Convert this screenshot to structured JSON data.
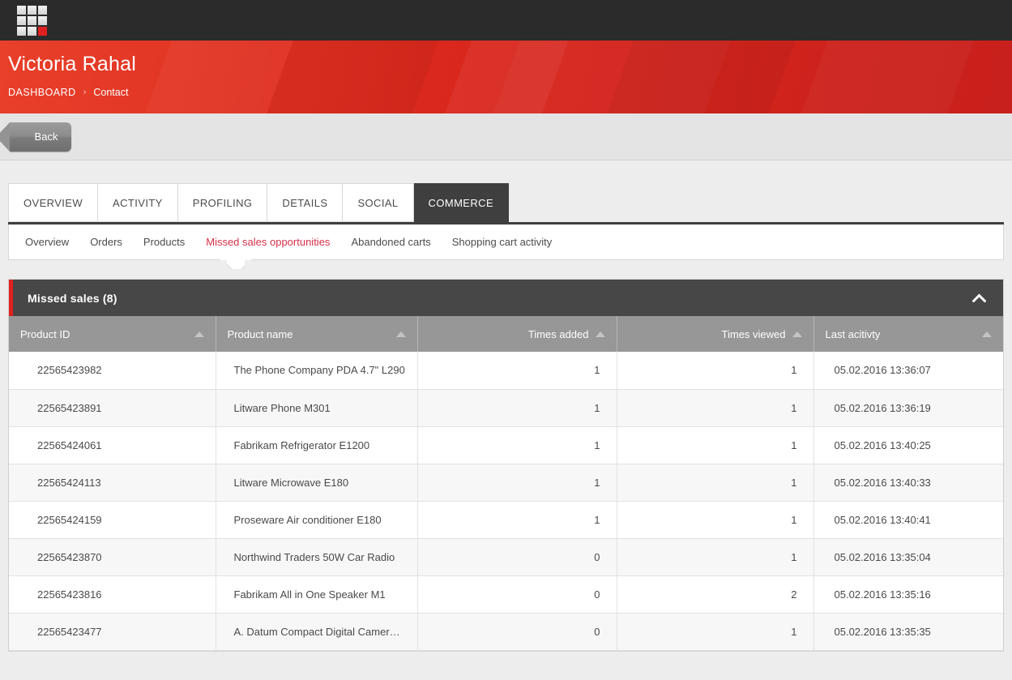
{
  "topbar": {
    "logo_name": "app-logo"
  },
  "hero": {
    "title": "Victoria Rahal",
    "breadcrumb": {
      "root": "DASHBOARD",
      "separator": "›",
      "current": "Contact"
    }
  },
  "toolbar": {
    "back_label": "Back"
  },
  "tabs": [
    {
      "label": "OVERVIEW",
      "active": false
    },
    {
      "label": "ACTIVITY",
      "active": false
    },
    {
      "label": "PROFILING",
      "active": false
    },
    {
      "label": "DETAILS",
      "active": false
    },
    {
      "label": "SOCIAL",
      "active": false
    },
    {
      "label": "COMMERCE",
      "active": true
    }
  ],
  "subnav": [
    {
      "label": "Overview",
      "active": false
    },
    {
      "label": "Orders",
      "active": false
    },
    {
      "label": "Products",
      "active": false
    },
    {
      "label": "Missed sales opportunities",
      "active": true
    },
    {
      "label": "Abandoned carts",
      "active": false
    },
    {
      "label": "Shopping cart activity",
      "active": false
    }
  ],
  "panel": {
    "title": "Missed sales (8)",
    "collapse_icon": "chevron-up-icon",
    "accent_color": "#e02020",
    "header_color": "#474747"
  },
  "table": {
    "columns": [
      {
        "label": "Product ID",
        "align": "left",
        "sort_icon": "sort-asc-icon"
      },
      {
        "label": "Product name",
        "align": "left",
        "sort_icon": "sort-asc-icon"
      },
      {
        "label": "Times added",
        "align": "right",
        "sort_icon": "sort-asc-icon"
      },
      {
        "label": "Times viewed",
        "align": "right",
        "sort_icon": "sort-asc-icon"
      },
      {
        "label": "Last acitivty",
        "align": "left",
        "sort_icon": "sort-asc-icon"
      }
    ],
    "rows": [
      {
        "product_id": "22565423982",
        "product_name": "The Phone Company PDA 4.7\" L290",
        "times_added": "1",
        "times_viewed": "1",
        "last_activity": "05.02.2016 13:36:07"
      },
      {
        "product_id": "22565423891",
        "product_name": "Litware Phone M301",
        "times_added": "1",
        "times_viewed": "1",
        "last_activity": "05.02.2016 13:36:19"
      },
      {
        "product_id": "22565424061",
        "product_name": "Fabrikam Refrigerator E1200",
        "times_added": "1",
        "times_viewed": "1",
        "last_activity": "05.02.2016 13:40:25"
      },
      {
        "product_id": "22565424113",
        "product_name": "Litware Microwave E180",
        "times_added": "1",
        "times_viewed": "1",
        "last_activity": "05.02.2016 13:40:33"
      },
      {
        "product_id": "22565424159",
        "product_name": "Proseware Air conditioner E180",
        "times_added": "1",
        "times_viewed": "1",
        "last_activity": "05.02.2016 13:40:41"
      },
      {
        "product_id": "22565423870",
        "product_name": "Northwind Traders 50W Car Radio",
        "times_added": "0",
        "times_viewed": "1",
        "last_activity": "05.02.2016 13:35:04"
      },
      {
        "product_id": "22565423816",
        "product_name": "Fabrikam All in One Speaker M1",
        "times_added": "0",
        "times_viewed": "2",
        "last_activity": "05.02.2016 13:35:16"
      },
      {
        "product_id": "22565423477",
        "product_name": "A. Datum Compact Digital Camera …",
        "times_added": "0",
        "times_viewed": "1",
        "last_activity": "05.02.2016 13:35:35"
      }
    ]
  }
}
